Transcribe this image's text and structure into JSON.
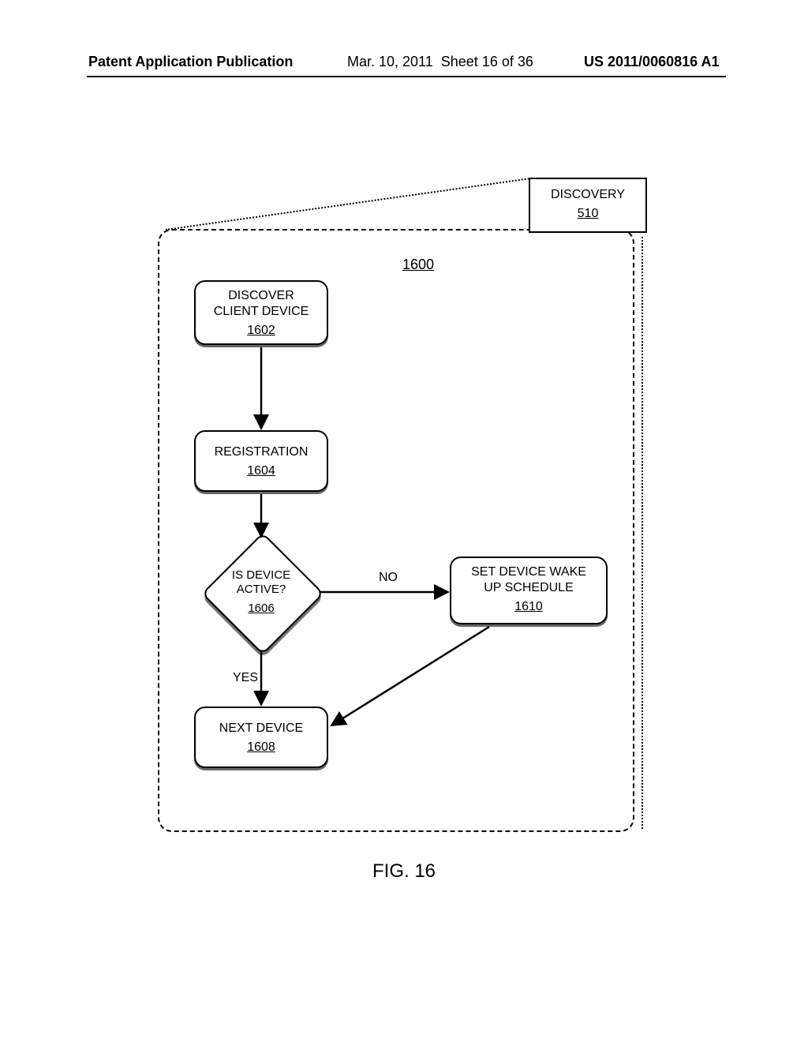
{
  "header": {
    "left": "Patent Application Publication",
    "date": "Mar. 10, 2011",
    "sheet": "Sheet 16 of 36",
    "pubno": "US 2011/0060816 A1"
  },
  "figure_caption": "FIG. 16",
  "discovery": {
    "label": "DISCOVERY",
    "ref": "510"
  },
  "process_ref": "1600",
  "boxes": {
    "discover": {
      "line1": "DISCOVER",
      "line2": "CLIENT DEVICE",
      "ref": "1602"
    },
    "registration": {
      "line1": "REGISTRATION",
      "ref": "1604"
    },
    "decision": {
      "line1": "IS DEVICE",
      "line2": "ACTIVE?",
      "ref": "1606"
    },
    "wakeup": {
      "line1": "SET DEVICE WAKE",
      "line2": "UP SCHEDULE",
      "ref": "1610"
    },
    "next": {
      "line1": "NEXT DEVICE",
      "ref": "1608"
    }
  },
  "labels": {
    "no": "NO",
    "yes": "YES"
  }
}
